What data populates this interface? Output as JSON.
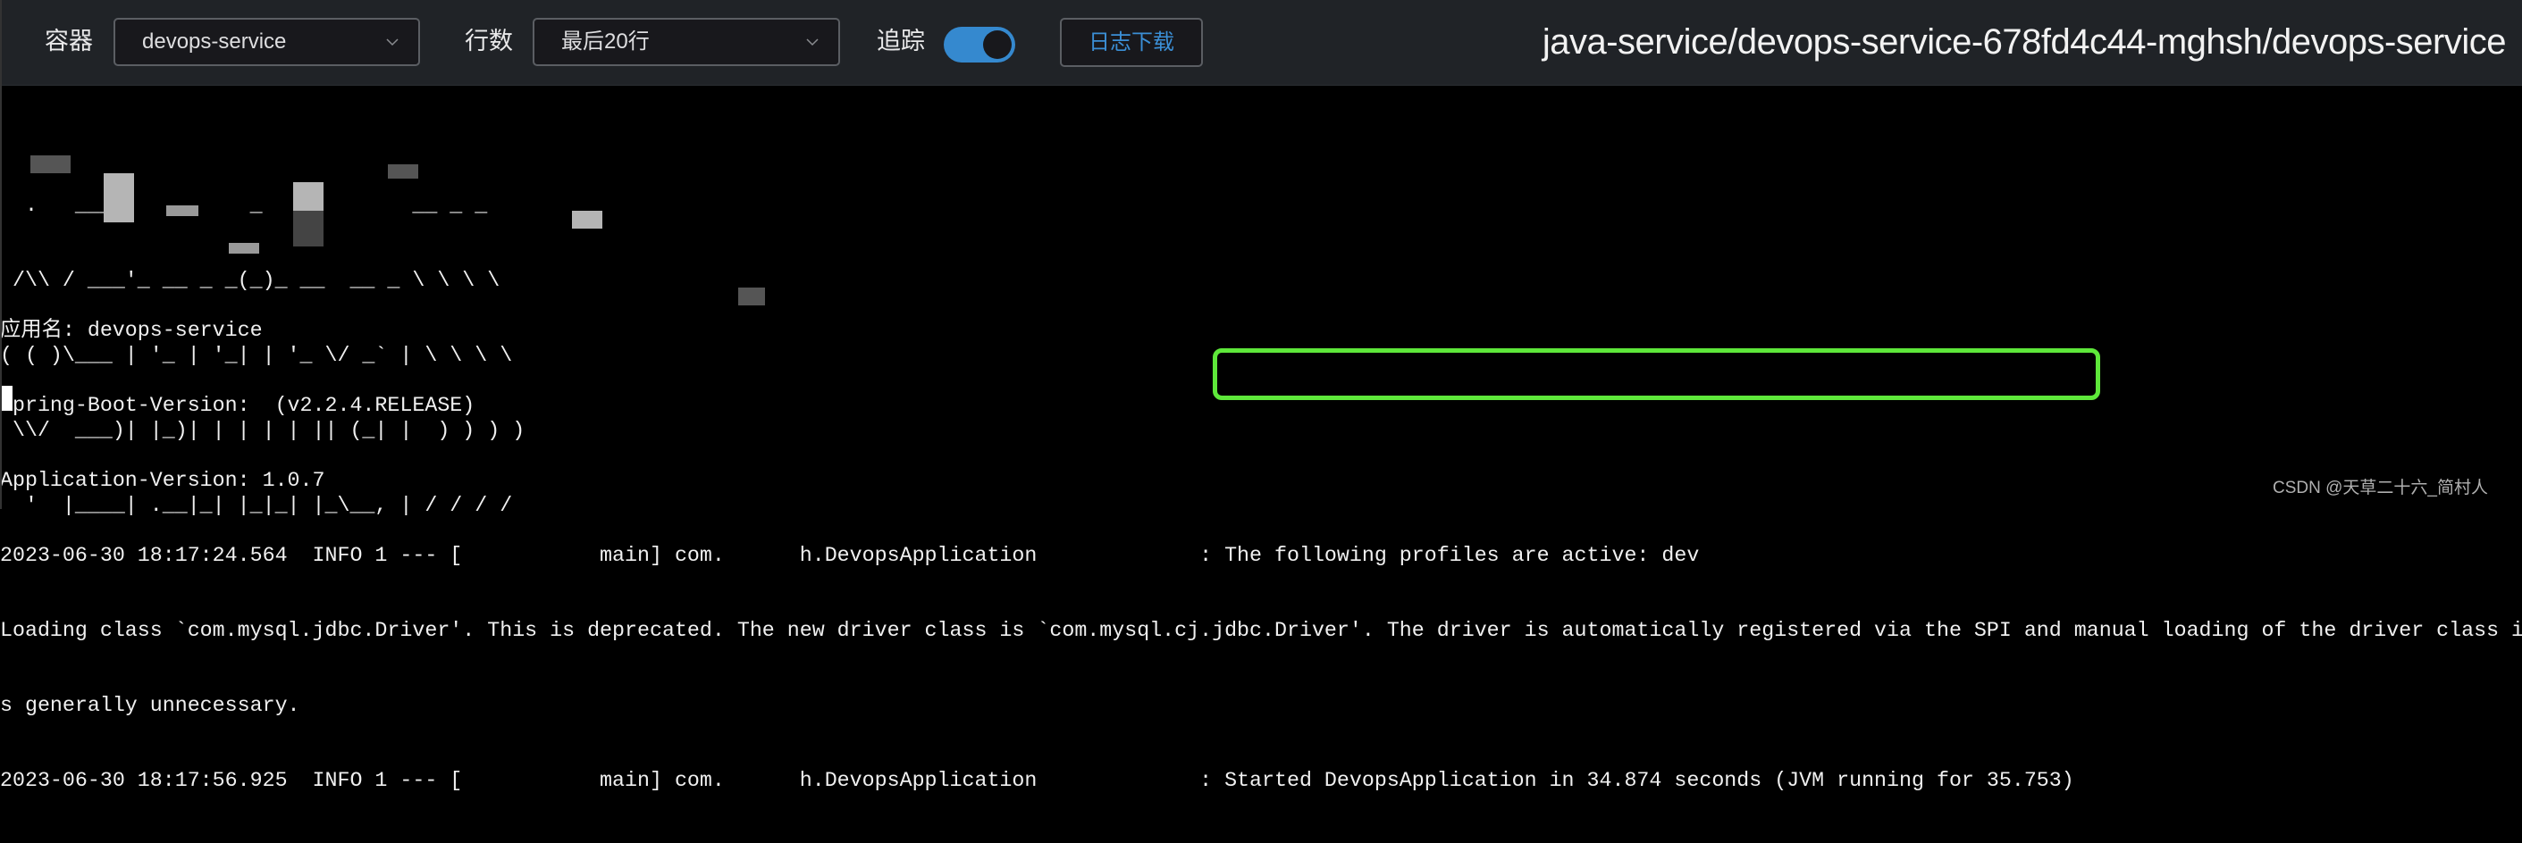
{
  "header": {
    "container_label": "容器",
    "container_value": "devops-service",
    "lines_label": "行数",
    "lines_value": "最后20行",
    "follow_label": "追踪",
    "follow_enabled": true,
    "download_button": "日志下载",
    "title": "java-service/devops-service-678fd4c44-mghsh/devops-service"
  },
  "colors": {
    "header_bg": "#202327",
    "accent": "#3589cf",
    "highlight": "#5ee83a",
    "log_bg": "#000000"
  },
  "log": {
    "banner": [
      "  .   ____          _            __ _ _",
      " /\\\\ / ___'_ __ _ _(_)_ __  __ _ \\ \\ \\ \\",
      "( ( )\\___ | '_ | '_| | '_ \\/ _` | \\ \\ \\ \\",
      " \\\\/  ___)| |_)| | | | | || (_| |  ) ) ) )",
      "  '  |____| .__|_| |_|_| |_\\__, | / / / /"
    ],
    "lines": [
      "应用名: devops-service",
      "Spring-Boot-Version:  (v2.2.4.RELEASE)",
      "Application-Version: 1.0.7",
      "2023-06-30 18:17:24.564  INFO 1 --- [           main] com.      h.DevopsApplication             : The following profiles are active: dev",
      "Loading class `com.mysql.jdbc.Driver'. This is deprecated. The new driver class is `com.mysql.cj.jdbc.Driver'. The driver is automatically registered via the SPI and manual loading of the driver class i",
      "s generally unnecessary.",
      "2023-06-30 18:17:56.925  INFO 1 --- [           main] com.      h.DevopsApplication             : Started DevopsApplication in 34.874 seconds (JVM running for 35.753)"
    ]
  },
  "watermark": "CSDN @天草二十六_简村人"
}
